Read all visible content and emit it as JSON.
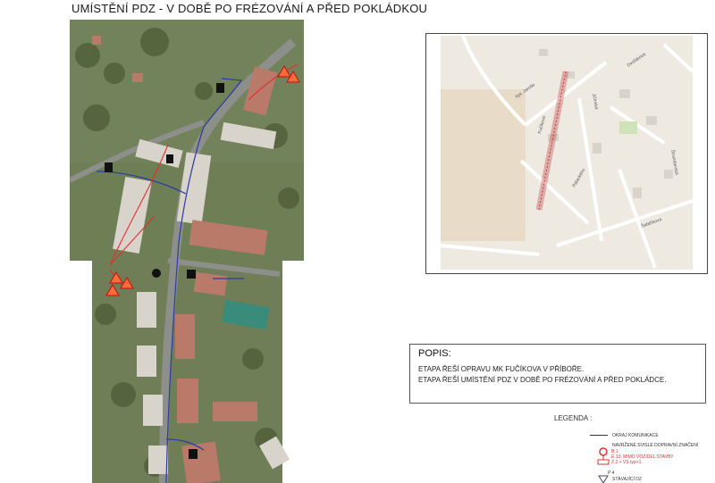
{
  "title": "UMÍSTĚNÍ PDZ - V DOBĚ PO FRÉZOVÁNÍ A PŘED POKLÁDKOU",
  "overview_map": {
    "street_labels": [
      "Fučíkova",
      "Štramberská",
      "Palackého",
      "Jičínská",
      "Šafaříkova",
      "Kpt. Jaroše",
      "Dvořákova"
    ]
  },
  "popis": {
    "heading": "POPIS:",
    "line1": "ETAPA ŘEŠÍ OPRAVU MK FUČÍKOVA V PŘÍBOŘE.",
    "line2": "ETAPA ŘEŠÍ UMÍSTĚNÍ PDZ V DOBĚ PO FRÉZOVÁNÍ A PŘED POKLÁDCE."
  },
  "legend": {
    "title": "LEGENDA :",
    "item1": "OKRAJ KOMUNIKACE",
    "item2": "NAVRŽENÉ SVISLÉ DOPRAVNÍ ZNAČENÍ",
    "item3_code": "B 1",
    "item3_text": "E 13: MIMO VOZIDEL STAVBY",
    "item3_sub": "Z 2 + VS typ+1",
    "item4_code": "P 4",
    "item4_text": "STÁVAJÍCÍ DZ"
  }
}
